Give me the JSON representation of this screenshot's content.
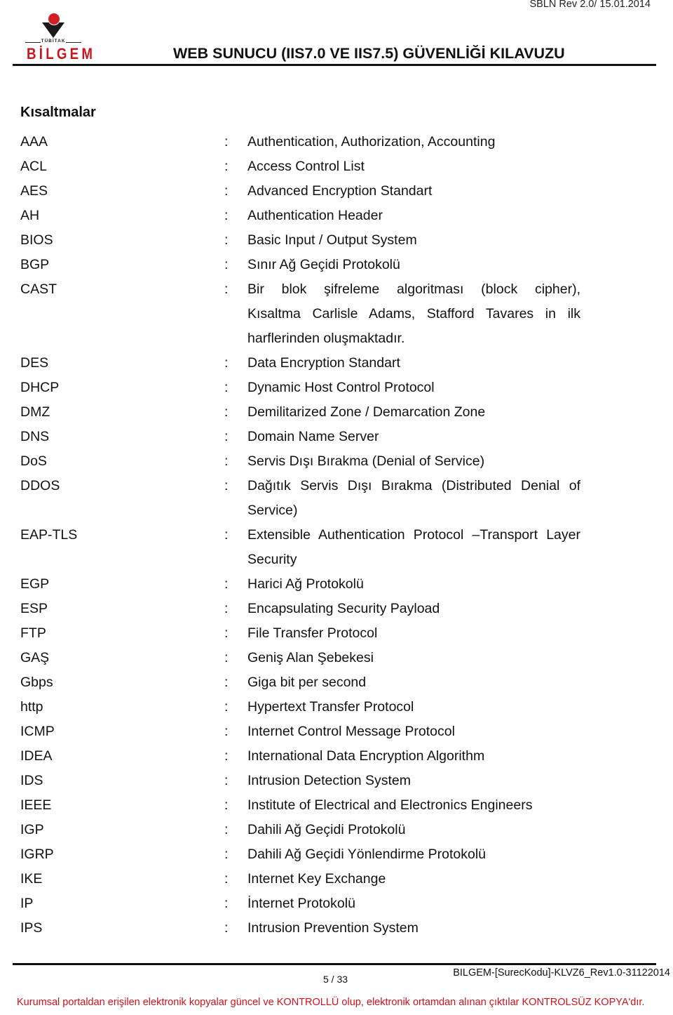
{
  "header": {
    "revision": "SBLN Rev 2.0/ 15.01.2014",
    "logo_org_small": "TÜBİTAK",
    "logo_org": "BİLGEM",
    "title": "WEB SUNUCU (IIS7.0 VE IIS7.5) GÜVENLİĞİ KILAVUZU",
    "brand_red": "#c8161d"
  },
  "section": {
    "title": "Kısaltmalar",
    "separator": ":",
    "items": [
      {
        "abbr": "AAA",
        "lines": [
          "Authentication, Authorization, Accounting"
        ]
      },
      {
        "abbr": "ACL",
        "lines": [
          "Access Control List"
        ]
      },
      {
        "abbr": "AES",
        "lines": [
          "Advanced Encryption Standart"
        ]
      },
      {
        "abbr": "AH",
        "lines": [
          "Authentication Header"
        ]
      },
      {
        "abbr": "BIOS",
        "lines": [
          "Basic Input / Output System"
        ]
      },
      {
        "abbr": "BGP",
        "lines": [
          "Sınır Ağ Geçidi Protokolü"
        ]
      },
      {
        "abbr": "CAST",
        "lines": [
          "Bir blok şifreleme algoritması (block  cipher),",
          "Kısaltma Carlisle  Adams, Stafford Tavares in ilk",
          "harflerinden oluşmaktadır."
        ]
      },
      {
        "abbr": "DES",
        "lines": [
          "Data Encryption Standart"
        ]
      },
      {
        "abbr": "DHCP",
        "lines": [
          "Dynamic Host Control Protocol"
        ]
      },
      {
        "abbr": "DMZ",
        "lines": [
          "Demilitarized Zone / Demarcation Zone"
        ]
      },
      {
        "abbr": "DNS",
        "lines": [
          "Domain Name Server"
        ]
      },
      {
        "abbr": "DoS",
        "lines": [
          "Servis Dışı Bırakma (Denial of Service)"
        ]
      },
      {
        "abbr": "DDOS",
        "lines": [
          "Dağıtık Servis Dışı Bırakma (Distributed Denial of",
          "Service)"
        ]
      },
      {
        "abbr": "EAP-TLS",
        "lines": [
          "Extensible Authentication Protocol –Transport Layer",
          "Security"
        ]
      },
      {
        "abbr": "EGP",
        "lines": [
          "Harici Ağ Protokolü"
        ]
      },
      {
        "abbr": "ESP",
        "lines": [
          "Encapsulating Security Payload"
        ]
      },
      {
        "abbr": "FTP",
        "lines": [
          "File Transfer Protocol"
        ]
      },
      {
        "abbr": "GAŞ",
        "lines": [
          "Geniş Alan Şebekesi"
        ]
      },
      {
        "abbr": "Gbps",
        "lines": [
          "Giga bit per second"
        ]
      },
      {
        "abbr": "http",
        "lines": [
          "Hypertext Transfer Protocol"
        ]
      },
      {
        "abbr": "ICMP",
        "lines": [
          "Internet Control Message Protocol"
        ]
      },
      {
        "abbr": "IDEA",
        "lines": [
          "International Data Encryption Algorithm"
        ]
      },
      {
        "abbr": "IDS",
        "lines": [
          "Intrusion Detection System"
        ]
      },
      {
        "abbr": "IEEE",
        "lines": [
          "Institute of Electrical and Electronics Engineers"
        ]
      },
      {
        "abbr": "IGP",
        "lines": [
          "Dahili Ağ Geçidi Protokolü"
        ]
      },
      {
        "abbr": "IGRP",
        "lines": [
          "Dahili Ağ Geçidi Yönlendirme Protokolü"
        ]
      },
      {
        "abbr": "IKE",
        "lines": [
          "Internet Key Exchange"
        ]
      },
      {
        "abbr": "IP",
        "lines": [
          "İnternet Protokolü"
        ]
      },
      {
        "abbr": "IPS",
        "lines": [
          "Intrusion Prevention System"
        ]
      }
    ]
  },
  "footer": {
    "page": "5 / 33",
    "doc_code": "BILGEM-[SurecKodu]-KLVZ6_Rev1.0-31122014",
    "notice": "Kurumsal portaldan erişilen elektronik kopyalar güncel ve KONTROLLÜ olup, elektronik ortamdan alınan çıktılar KONTROLSÜZ KOPYA'dır.",
    "notice_color": "#d0121b"
  }
}
